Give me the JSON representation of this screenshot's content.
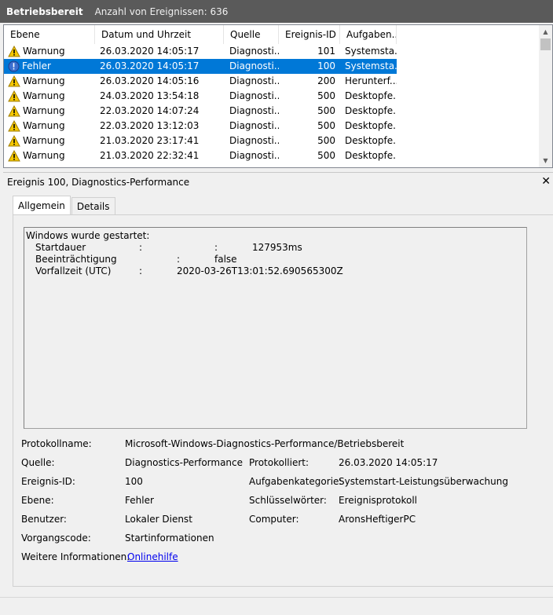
{
  "header": {
    "title": "Betriebsbereit",
    "count_label": "Anzahl von Ereignissen: 636"
  },
  "columns": [
    "Ebene",
    "Datum und Uhrzeit",
    "Quelle",
    "Ereignis-ID",
    "Aufgaben..."
  ],
  "rows": [
    {
      "level": "Warnung",
      "icon": "warning-icon",
      "date": "26.03.2020 14:05:17",
      "source": "Diagnosti...",
      "id": "101",
      "task": "Systemsta..."
    },
    {
      "level": "Fehler",
      "icon": "error-icon",
      "date": "26.03.2020 14:05:17",
      "source": "Diagnosti...",
      "id": "100",
      "task": "Systemsta...",
      "selected": true
    },
    {
      "level": "Warnung",
      "icon": "warning-icon",
      "date": "26.03.2020 14:05:16",
      "source": "Diagnosti...",
      "id": "200",
      "task": "Herunterf..."
    },
    {
      "level": "Warnung",
      "icon": "warning-icon",
      "date": "24.03.2020 13:54:18",
      "source": "Diagnosti...",
      "id": "500",
      "task": "Desktopfe..."
    },
    {
      "level": "Warnung",
      "icon": "warning-icon",
      "date": "22.03.2020 14:07:24",
      "source": "Diagnosti...",
      "id": "500",
      "task": "Desktopfe..."
    },
    {
      "level": "Warnung",
      "icon": "warning-icon",
      "date": "22.03.2020 13:12:03",
      "source": "Diagnosti...",
      "id": "500",
      "task": "Desktopfe..."
    },
    {
      "level": "Warnung",
      "icon": "warning-icon",
      "date": "21.03.2020 23:17:41",
      "source": "Diagnosti...",
      "id": "500",
      "task": "Desktopfe..."
    },
    {
      "level": "Warnung",
      "icon": "warning-icon",
      "date": "21.03.2020 22:32:41",
      "source": "Diagnosti...",
      "id": "500",
      "task": "Desktopfe..."
    }
  ],
  "detail": {
    "title": "Ereignis 100, Diagnostics-Performance",
    "close": "✕",
    "tabs": [
      "Allgemein",
      "Details"
    ],
    "message": {
      "heading": "Windows wurde gestartet:",
      "lines": [
        {
          "label": "Startdauer",
          "sep": ":",
          "sep2": ":",
          "value": "127953ms"
        },
        {
          "label": "Beeinträchtigung",
          "sep": ":",
          "value": "false"
        },
        {
          "label": "Vorfallzeit (UTC)",
          "sep": ":",
          "value": "2020-03-26T13:01:52.690565300Z"
        }
      ]
    },
    "props": {
      "log_name_label": "Protokollname:",
      "log_name": "Microsoft-Windows-Diagnostics-Performance/Betriebsbereit",
      "source_label": "Quelle:",
      "source": "Diagnostics-Performance",
      "logged_label": "Protokolliert:",
      "logged": "26.03.2020 14:05:17",
      "event_id_label": "Ereignis-ID:",
      "event_id": "100",
      "task_cat_label": "Aufgabenkategorie:",
      "task_cat": "Systemstart-Leistungsüberwachung",
      "level_label": "Ebene:",
      "level": "Fehler",
      "keywords_label": "Schlüsselwörter:",
      "keywords": "Ereignisprotokoll",
      "user_label": "Benutzer:",
      "user": "Lokaler Dienst",
      "computer_label": "Computer:",
      "computer": "AronsHeftigerPC",
      "opcode_label": "Vorgangscode:",
      "opcode": "Startinformationen",
      "more_info_label": "Weitere Informationen:",
      "more_info_link": "Onlinehilfe"
    }
  },
  "colors": {
    "selection": "#0078d7",
    "titlebar": "#5a5a5a",
    "link": "#0000ee"
  }
}
